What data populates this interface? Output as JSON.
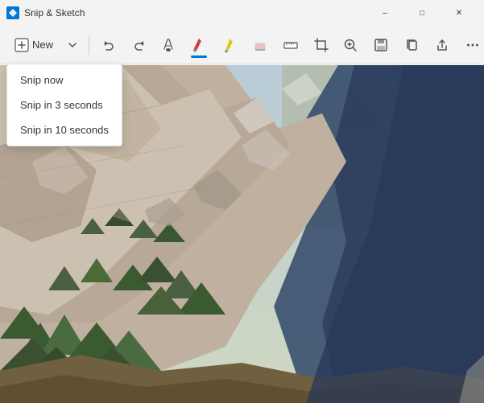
{
  "titleBar": {
    "title": "Snip & Sketch",
    "minimizeLabel": "–",
    "maximizeLabel": "□",
    "closeLabel": "✕"
  },
  "toolbar": {
    "newLabel": "New",
    "undoTitle": "Undo",
    "redoTitle": "Redo",
    "tools": [
      {
        "id": "ballpoint",
        "title": "Ballpoint pen",
        "active": false
      },
      {
        "id": "pencil",
        "title": "Pencil",
        "active": true
      },
      {
        "id": "highlighter",
        "title": "Highlighter",
        "active": false
      },
      {
        "id": "eraser",
        "title": "Eraser",
        "active": false
      },
      {
        "id": "ruler",
        "title": "Ruler",
        "active": false
      },
      {
        "id": "crop",
        "title": "Crop",
        "active": false
      }
    ],
    "rightTools": [
      {
        "id": "zoom-in",
        "title": "Zoom in"
      },
      {
        "id": "save",
        "title": "Save as"
      },
      {
        "id": "copy",
        "title": "Copy"
      },
      {
        "id": "share",
        "title": "Share"
      },
      {
        "id": "more",
        "title": "More options"
      }
    ]
  },
  "dropdown": {
    "visible": true,
    "items": [
      {
        "id": "snip-now",
        "label": "Snip now"
      },
      {
        "id": "snip-3",
        "label": "Snip in 3 seconds"
      },
      {
        "id": "snip-10",
        "label": "Snip in 10 seconds"
      }
    ]
  },
  "colors": {
    "accent": "#0078d4",
    "toolbar": "#f3f3f3",
    "border": "#e0e0e0"
  }
}
